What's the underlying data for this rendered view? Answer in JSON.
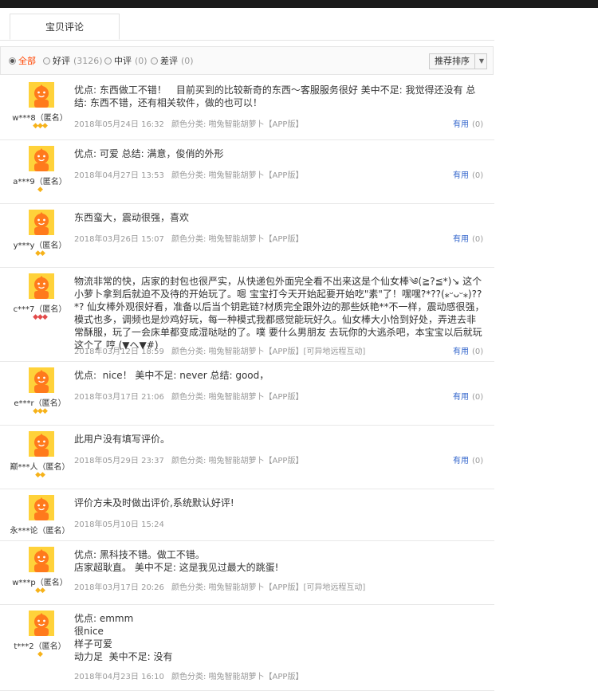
{
  "tabs": {
    "active": "宝贝评论"
  },
  "filter": {
    "all": "全部",
    "good": "好评",
    "good_count": "(3126)",
    "mid": "中评",
    "mid_count": "(0)",
    "bad": "差评",
    "bad_count": "(0)",
    "sort_label": "推荐排序",
    "sort_arrow": "▼"
  },
  "colors": {
    "accent": "#ff4400",
    "link": "#3366cc",
    "gem_gold": "#f6b21a",
    "gem_red": "#e24b4b"
  },
  "reviews": [
    {
      "user": "w***8（匿名）",
      "level": "gold",
      "gems": 3,
      "lines": [
        "优点: 东西做工不错！　目前买到的比较新奇的东西～客服服务很好 美中不足: 我觉得还没有 总结: 东西不错，还有相关软件，做的也可以！"
      ],
      "date": "2018年05月24日 16:32",
      "sku": "颜色分类: 啪兔智能胡萝卜【APP版】",
      "useful": "有用",
      "useful_count": "(0)"
    },
    {
      "user": "a***9（匿名）",
      "level": "gold",
      "gems": 1,
      "lines": [
        "优点: 可爱 总结: 满意，俊俏的外形"
      ],
      "date": "2018年04月27日 13:53",
      "sku": "颜色分类: 啪兔智能胡萝卜【APP版】",
      "useful": "有用",
      "useful_count": "(0)"
    },
    {
      "user": "y***y（匿名）",
      "level": "gold",
      "gems": 2,
      "lines": [
        "东西蛮大，震动很强，喜欢"
      ],
      "date": "2018年03月26日 15:07",
      "sku": "颜色分类: 啪兔智能胡萝卜【APP版】",
      "useful": "有用",
      "useful_count": "(0)"
    },
    {
      "user": "c***7（匿名）",
      "level": "red",
      "gems": 3,
      "lines": [
        "物流非常的快，店家的封包也很严实，从快递包外面完全看不出来这是个仙女棒༄(≧?≦*)↘ 这个小萝卜拿到后就迫不及待的开始玩了。嗯 宝宝打今天开始起要开始吃\"素\"了！嘿嘿?*??(⁎ᵕᴗᵕ⁎)??*? 仙女棒外观很好看，准备以后当个钥匙链?材质完全跟外边的那些妖艳**不一样，震动感很强，模式也多，调频也是炒鸡好玩，每一种模式我都感觉能玩好久。仙女棒大小恰到好处，弄进去非常酥服，玩了一会床单都变成湿哒哒的了。噗 要什么男朋友 去玩你的大逃杀吧，本宝宝以后就玩这个了 哼 (▼ヘ▼#)"
      ],
      "date": "2018年03月12日 18:59",
      "sku": "颜色分类: 啪兔智能胡萝卜【APP版】[可异地远程互动]",
      "useful": "有用",
      "useful_count": "(0)"
    },
    {
      "user": "e***r（匿名）",
      "level": "gold",
      "gems": 3,
      "lines": [
        "优点:  nice！ 美中不足: never 总结: good，"
      ],
      "date": "2018年03月17日 21:06",
      "sku": "颜色分类: 啪兔智能胡萝卜【APP版】",
      "useful": "有用",
      "useful_count": "(0)"
    },
    {
      "user": "巅***人（匿名）",
      "level": "gold",
      "gems": 2,
      "lines": [
        "此用户没有填写评价。"
      ],
      "date": "2018年05月29日 23:37",
      "sku": "颜色分类: 啪兔智能胡萝卜【APP版】",
      "useful": "有用",
      "useful_count": "(0)"
    },
    {
      "user": "永***论（匿名）",
      "level": "none",
      "gems": 0,
      "lines": [
        "评价方未及时做出评价,系统默认好评!"
      ],
      "date": "2018年05月10日 15:24",
      "sku": "",
      "useful": "",
      "useful_count": ""
    },
    {
      "user": "w***p（匿名）",
      "level": "gold",
      "gems": 2,
      "lines": [
        "优点: 黑科技不错。做工不错。",
        "店家超耿直。 美中不足: 这是我见过最大的跳蛋!"
      ],
      "date": "2018年03月17日 20:26",
      "sku": "颜色分类: 啪兔智能胡萝卜【APP版】[可异地远程互动]",
      "useful": "",
      "useful_count": ""
    },
    {
      "user": "t***2（匿名）",
      "level": "gold",
      "gems": 1,
      "lines": [
        "优点: emmm",
        "很nice",
        "样子可爱",
        "动力足  美中不足: 没有"
      ],
      "date": "2018年04月23日 16:10",
      "sku": "颜色分类: 啪兔智能胡萝卜【APP版】",
      "useful": "",
      "useful_count": ""
    }
  ]
}
